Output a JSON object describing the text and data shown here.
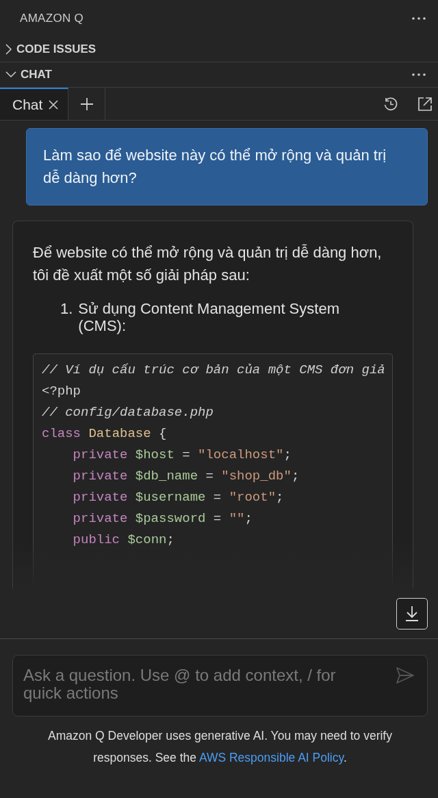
{
  "panel": {
    "title": "AMAZON Q"
  },
  "sections": [
    {
      "label": "CODE ISSUES",
      "expanded": false
    },
    {
      "label": "CHAT",
      "expanded": true
    }
  ],
  "tabs": [
    {
      "label": "Chat",
      "selected": true
    }
  ],
  "messages": [
    {
      "kind": "user",
      "text": "Làm sao để website này có thể mở rộng và quản trị dễ dàng hơn?"
    },
    {
      "kind": "answer",
      "paragraph": "Để website có thể mở rộng và quản trị dễ dàng hơn, tôi đề xuất một số giải pháp sau:",
      "list": [
        {
          "number": "1.",
          "text": "Sử dụng Content Management System (CMS):"
        }
      ],
      "code": [
        {
          "indented": false,
          "tokens": [
            {
              "kind": "comment",
              "text": "// Ví dụ cấu trúc cơ bản của một CMS đơn giả"
            }
          ]
        },
        {
          "indented": false,
          "tokens": [
            {
              "kind": "plain",
              "text": "<?php"
            }
          ]
        },
        {
          "indented": false,
          "tokens": [
            {
              "kind": "comment",
              "text": "// config/database.php"
            }
          ]
        },
        {
          "indented": false,
          "tokens": [
            {
              "kind": "keyword",
              "text": "class "
            },
            {
              "kind": "type",
              "text": "Database"
            },
            {
              "kind": "plain",
              "text": " {"
            }
          ]
        },
        {
          "indented": true,
          "tokens": [
            {
              "kind": "keyword",
              "text": "private "
            },
            {
              "kind": "variable",
              "text": "$host"
            },
            {
              "kind": "plain",
              "text": " = "
            },
            {
              "kind": "string",
              "text": "\"localhost\""
            },
            {
              "kind": "plain",
              "text": ";"
            }
          ]
        },
        {
          "indented": true,
          "tokens": [
            {
              "kind": "keyword",
              "text": "private "
            },
            {
              "kind": "variable",
              "text": "$db_name"
            },
            {
              "kind": "plain",
              "text": " = "
            },
            {
              "kind": "string",
              "text": "\"shop_db\""
            },
            {
              "kind": "plain",
              "text": ";"
            }
          ]
        },
        {
          "indented": true,
          "tokens": [
            {
              "kind": "keyword",
              "text": "private "
            },
            {
              "kind": "variable",
              "text": "$username"
            },
            {
              "kind": "plain",
              "text": " = "
            },
            {
              "kind": "string",
              "text": "\"root\""
            },
            {
              "kind": "plain",
              "text": ";"
            }
          ]
        },
        {
          "indented": true,
          "tokens": [
            {
              "kind": "keyword",
              "text": "private "
            },
            {
              "kind": "variable",
              "text": "$password"
            },
            {
              "kind": "plain",
              "text": " = "
            },
            {
              "kind": "string",
              "text": "\"\""
            },
            {
              "kind": "plain",
              "text": ";"
            }
          ]
        },
        {
          "indented": true,
          "tokens": [
            {
              "kind": "keyword",
              "text": "public "
            },
            {
              "kind": "variable",
              "text": "$conn"
            },
            {
              "kind": "plain",
              "text": ";"
            }
          ]
        }
      ]
    }
  ],
  "input": {
    "placeholder": "Ask a question. Use @ to add context, / for quick actions"
  },
  "footer": {
    "text": "Amazon Q Developer uses generative AI. You may need to verify responses. See the ",
    "link": "AWS Responsible AI Policy",
    "after": "."
  }
}
